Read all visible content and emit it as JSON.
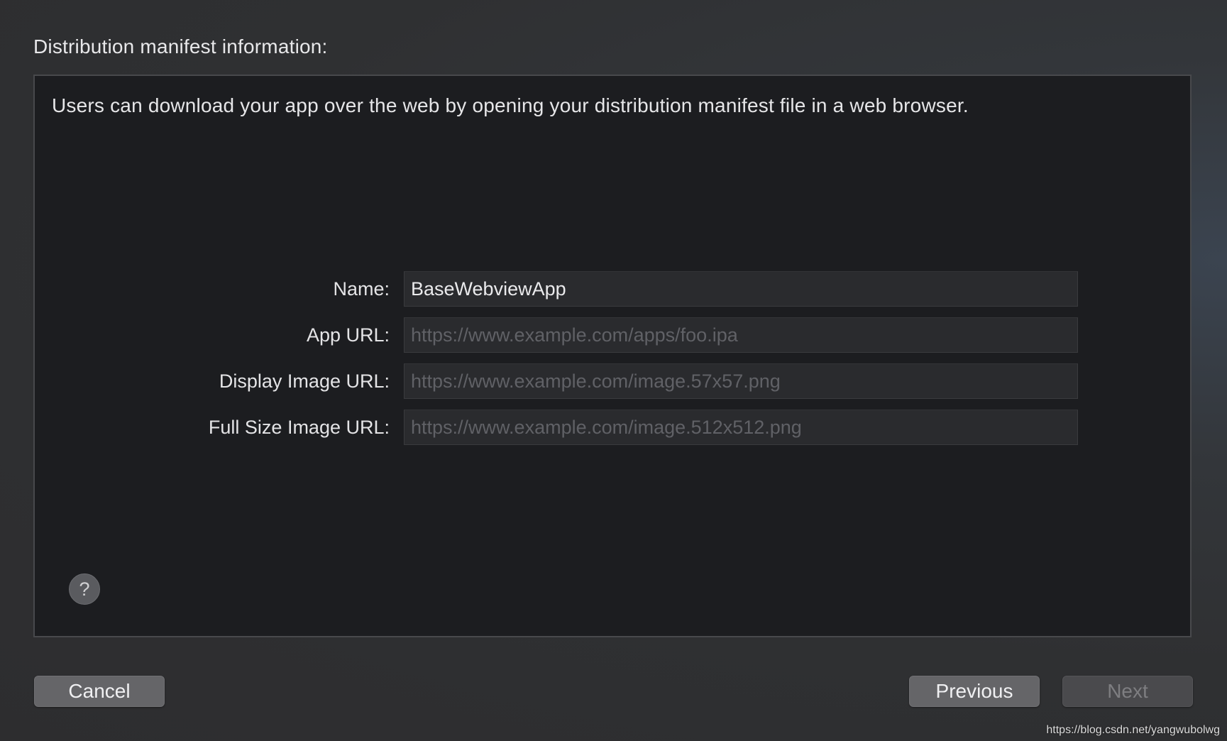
{
  "dialog": {
    "title": "Distribution manifest information:",
    "intro": "Users can download your app over the web by opening your distribution manifest file in a web browser."
  },
  "form": {
    "name": {
      "label": "Name:",
      "value": "BaseWebviewApp",
      "placeholder": ""
    },
    "app_url": {
      "label": "App URL:",
      "value": "",
      "placeholder": "https://www.example.com/apps/foo.ipa"
    },
    "display_image_url": {
      "label": "Display Image URL:",
      "value": "",
      "placeholder": "https://www.example.com/image.57x57.png"
    },
    "full_size_image_url": {
      "label": "Full Size Image URL:",
      "value": "",
      "placeholder": "https://www.example.com/image.512x512.png"
    }
  },
  "help": {
    "icon": "question-mark-icon",
    "glyph": "?"
  },
  "buttons": {
    "cancel": "Cancel",
    "previous": "Previous",
    "next": "Next"
  },
  "watermark": "https://blog.csdn.net/yangwubolwg"
}
